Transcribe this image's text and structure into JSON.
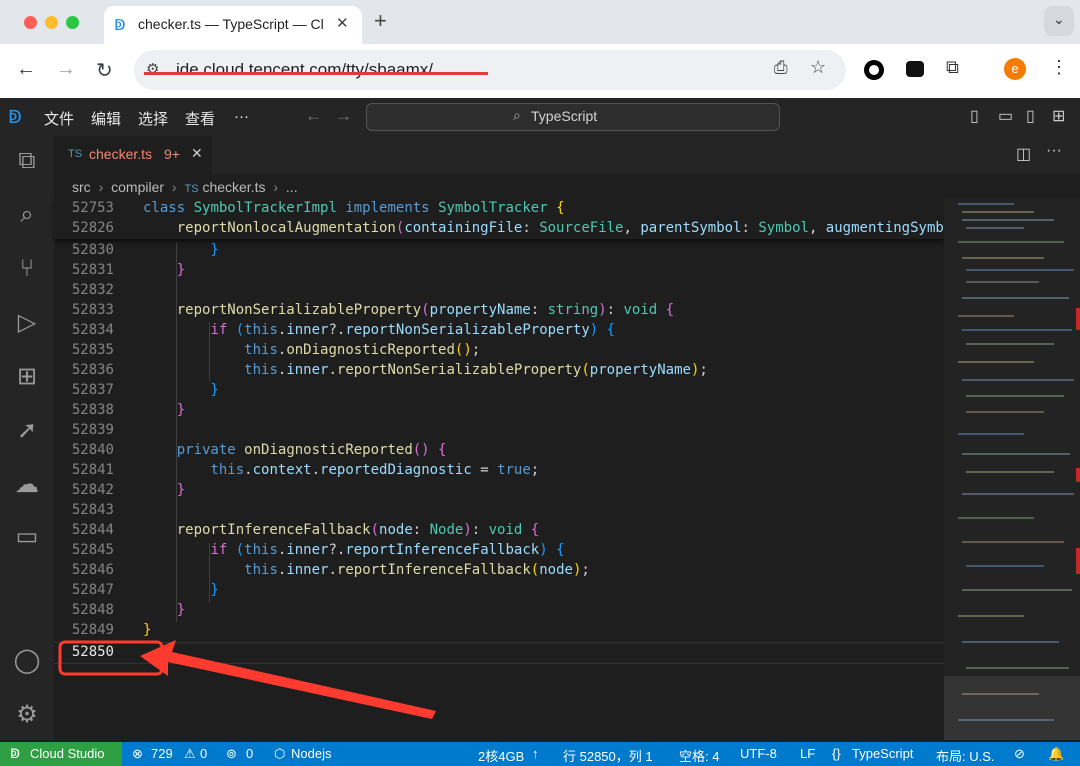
{
  "browser": {
    "tab_title": "checker.ts — TypeScript — Cl",
    "new_tab": "+",
    "url": "ide.cloud.tencent.com/tty/sbaamx/",
    "profile_initial": "e"
  },
  "menu": {
    "file": "文件",
    "edit": "编辑",
    "select": "选择",
    "view": "查看",
    "more": "···"
  },
  "search": {
    "label": "TypeScript"
  },
  "editor_tab": {
    "lang": "TS",
    "name": "checker.ts",
    "badge": "9+"
  },
  "breadcrumb": {
    "seg1": "src",
    "seg2": "compiler",
    "seg3_lang": "TS",
    "seg3": "checker.ts",
    "seg4": "..."
  },
  "sticky": [
    {
      "line": "52753",
      "code": "class SymbolTrackerImpl implements SymbolTracker {"
    },
    {
      "line": "52826",
      "code": "    reportNonlocalAugmentation(containingFile: SourceFile, parentSymbol: Symbol, augmentingSymbol: S"
    }
  ],
  "lines": [
    {
      "line": "52830",
      "code": "        }"
    },
    {
      "line": "52831",
      "code": "    }"
    },
    {
      "line": "52832",
      "code": ""
    },
    {
      "line": "52833",
      "code": "    reportNonSerializableProperty(propertyName: string): void {"
    },
    {
      "line": "52834",
      "code": "        if (this.inner?.reportNonSerializableProperty) {"
    },
    {
      "line": "52835",
      "code": "            this.onDiagnosticReported();"
    },
    {
      "line": "52836",
      "code": "            this.inner.reportNonSerializableProperty(propertyName);"
    },
    {
      "line": "52837",
      "code": "        }"
    },
    {
      "line": "52838",
      "code": "    }"
    },
    {
      "line": "52839",
      "code": ""
    },
    {
      "line": "52840",
      "code": "    private onDiagnosticReported() {"
    },
    {
      "line": "52841",
      "code": "        this.context.reportedDiagnostic = true;"
    },
    {
      "line": "52842",
      "code": "    }"
    },
    {
      "line": "52843",
      "code": ""
    },
    {
      "line": "52844",
      "code": "    reportInferenceFallback(node: Node): void {"
    },
    {
      "line": "52845",
      "code": "        if (this.inner?.reportInferenceFallback) {"
    },
    {
      "line": "52846",
      "code": "            this.inner.reportInferenceFallback(node);"
    },
    {
      "line": "52847",
      "code": "        }"
    },
    {
      "line": "52848",
      "code": "    }"
    },
    {
      "line": "52849",
      "code": "}"
    },
    {
      "line": "52850",
      "code": ""
    }
  ],
  "status": {
    "brand": "Cloud Studio",
    "errors": "729",
    "warnings": "0",
    "ports": "0",
    "env": "Nodejs",
    "resources": "2核4GB",
    "position": "行 52850，列 1",
    "spaces": "空格: 4",
    "encoding": "UTF-8",
    "eol": "LF",
    "language": "TypeScript",
    "layout": "布局: U.S."
  },
  "annotation": {
    "color": "#ff3b2f"
  }
}
